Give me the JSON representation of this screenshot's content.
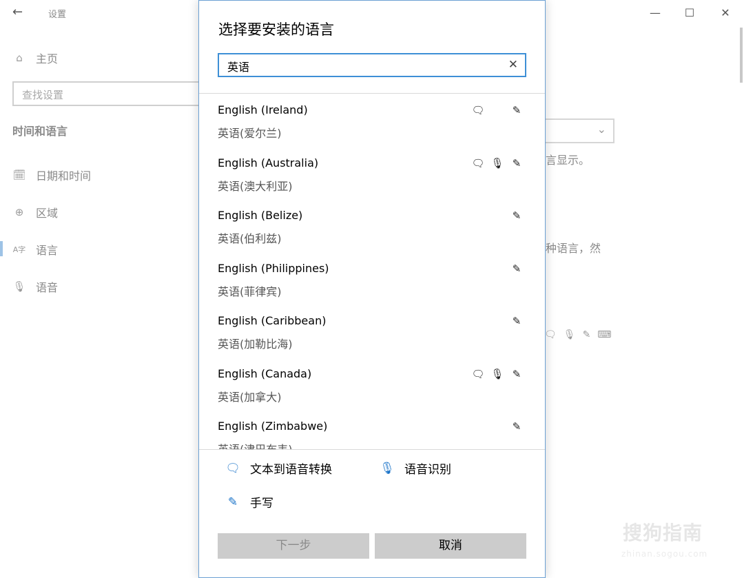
{
  "background_window": {
    "title": "设置",
    "back_glyph": "←",
    "controls": {
      "minimize": "—",
      "maximize": "☐",
      "close": "✕"
    },
    "home_label": "主页",
    "search_placeholder": "查找设置",
    "section_title": "时间和语言",
    "nav_items": [
      {
        "label": "日期和时间",
        "icon": "calendar-clock-icon",
        "glyph": "🗓"
      },
      {
        "label": "区域",
        "icon": "globe-icon",
        "glyph": "⊕"
      },
      {
        "label": "语言",
        "icon": "language-icon",
        "glyph": "A字"
      },
      {
        "label": "语音",
        "icon": "microphone-icon",
        "glyph": "🎙"
      }
    ],
    "right_fragments": {
      "line1": "言显示。",
      "line2": "种语言，然"
    }
  },
  "dialog": {
    "title": "选择要安装的语言",
    "search_value": "英语",
    "clear_glyph": "✕",
    "languages": [
      {
        "en": "English (Ireland)",
        "zh": "英语(爱尔兰)",
        "features": [
          "tts",
          "handwriting"
        ]
      },
      {
        "en": "English (Australia)",
        "zh": "英语(澳大利亚)",
        "features": [
          "tts",
          "speech",
          "handwriting"
        ]
      },
      {
        "en": "English (Belize)",
        "zh": "英语(伯利兹)",
        "features": [
          "handwriting"
        ]
      },
      {
        "en": "English (Philippines)",
        "zh": "英语(菲律宾)",
        "features": [
          "handwriting"
        ]
      },
      {
        "en": "English (Caribbean)",
        "zh": "英语(加勒比海)",
        "features": [
          "handwriting"
        ]
      },
      {
        "en": "English (Canada)",
        "zh": "英语(加拿大)",
        "features": [
          "tts",
          "speech",
          "handwriting"
        ]
      },
      {
        "en": "English (Zimbabwe)",
        "zh": "英语(津巴布韦)",
        "features": [
          "handwriting"
        ]
      }
    ],
    "legend": {
      "tts": "文本到语音转换",
      "speech": "语音识别",
      "handwriting": "手写"
    },
    "buttons": {
      "next": "下一步",
      "cancel": "取消"
    }
  },
  "watermark": {
    "main": "搜狗指南",
    "sub": "zhinan.sogou.com"
  },
  "colors": {
    "accent": "#3d8fd6",
    "legend_icon": "#1a73c8",
    "button_bg": "#cccccc"
  }
}
